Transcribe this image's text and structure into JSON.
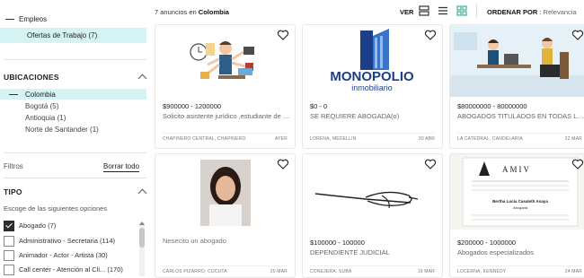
{
  "sidebar": {
    "categoria_padre": "Empleos",
    "categoria_activa": "Ofertas de Trabajo (7)",
    "ubicaciones": {
      "titulo": "UBICACIONES",
      "activa": "Colombia",
      "items": [
        "Bogotá (5)",
        "Antioquia (1)",
        "Norte de Santander (1)"
      ]
    },
    "filtros_label": "Filtros",
    "borrar_label": "Borrar todo",
    "tipo": {
      "titulo": "TIPO",
      "hint": "Escoge de las siguientes opciones",
      "opciones": [
        {
          "label": "Abogado (7)",
          "checked": true
        },
        {
          "label": "Administrativo - Secretaria (114)",
          "checked": false
        },
        {
          "label": "Animador - Actor - Artista (30)",
          "checked": false
        },
        {
          "label": "Call center - Atención al Cli... (170)",
          "checked": false
        }
      ]
    }
  },
  "toolbar": {
    "count_prefix": "7 anuncios en",
    "count_place": "Colombia",
    "ver_label": "VER",
    "ordenar_label": "ORDENAR POR",
    "ordenar_value": "Relevancia"
  },
  "cards": [
    {
      "price": "$900000 - 1200000",
      "title": "Solicito asistente jurídico ,estudiante de d...",
      "location": "CHAPINERO CENTRAL, CHAPINERO",
      "date": "AYER",
      "image": "multitasking-worker-illustration"
    },
    {
      "price": "$0 - 0",
      "title": "SE REQUIERE ABOGADA(o)",
      "location": "LORENA, MEDELLIN",
      "date": "30 ABR",
      "image": "monopolio-logo",
      "logo_main": "MONOPOLIO",
      "logo_sub": "inmobiliario"
    },
    {
      "price": "$80000000 - 80000000",
      "title": "ABOGADOS TITULADOS EN TODAS LAS A...",
      "location": "LA CATEDRAL, CANDELARIA",
      "date": "22 MAR",
      "image": "office-meeting-illustration"
    },
    {
      "price": "Nesecito un abogado",
      "title": "",
      "location": "CARLOS PIZARRO, CÚCUTA",
      "date": "20 MAR",
      "image": "portrait-photo"
    },
    {
      "price": "$100000 - 100000",
      "title": "DEPENDIENTE JUDICIAL",
      "location": "CONEJERA, SUBA",
      "date": "19 MAR",
      "image": "pen-sketch"
    },
    {
      "price": "$200000 - 1000000",
      "title": "Abogados especializados",
      "location": "LOCERNA, KENNEDY",
      "date": "24 MAR",
      "image": "business-card",
      "card_brand": "AMIV",
      "card_person": "Bertha Lucía Casaleth Anaya",
      "card_role": "Abogada"
    }
  ],
  "colors": {
    "accent": "#d6f3f4",
    "grid_icon": "#3fae95"
  }
}
